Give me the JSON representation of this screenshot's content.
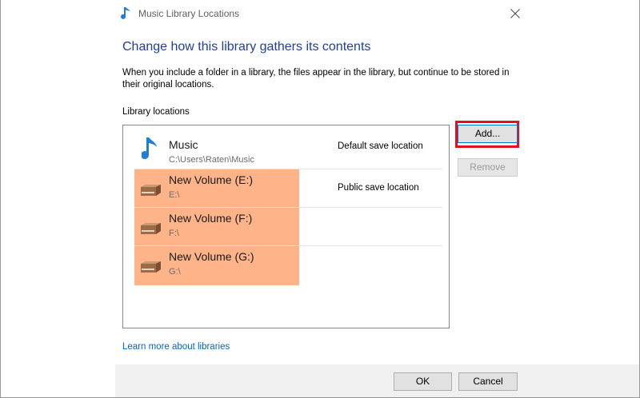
{
  "window": {
    "title": "Music Library Locations"
  },
  "content": {
    "heading": "Change how this library gathers its contents",
    "description": "When you include a folder in a library, the files appear in the library, but continue to be stored in their original locations.",
    "locations_label": "Library locations"
  },
  "locations": [
    {
      "name": "Music",
      "path": "C:\\Users\\Raten\\Music",
      "tag": "Default save location",
      "icon": "music-note-icon"
    },
    {
      "name": "New Volume (E:)",
      "path": "E:\\",
      "tag": "Public save location",
      "icon": "drive-icon"
    },
    {
      "name": "New Volume (F:)",
      "path": "F:\\",
      "tag": "",
      "icon": "drive-icon"
    },
    {
      "name": "New Volume (G:)",
      "path": "G:\\",
      "tag": "",
      "icon": "drive-icon"
    }
  ],
  "buttons": {
    "add": "Add...",
    "remove": "Remove",
    "ok": "OK",
    "cancel": "Cancel"
  },
  "links": {
    "learn_more": "Learn more about libraries"
  },
  "colors": {
    "heading": "#1e3f9b",
    "link": "#0066cc",
    "highlight": "#ff965a",
    "add_outline": "#e1101c"
  }
}
